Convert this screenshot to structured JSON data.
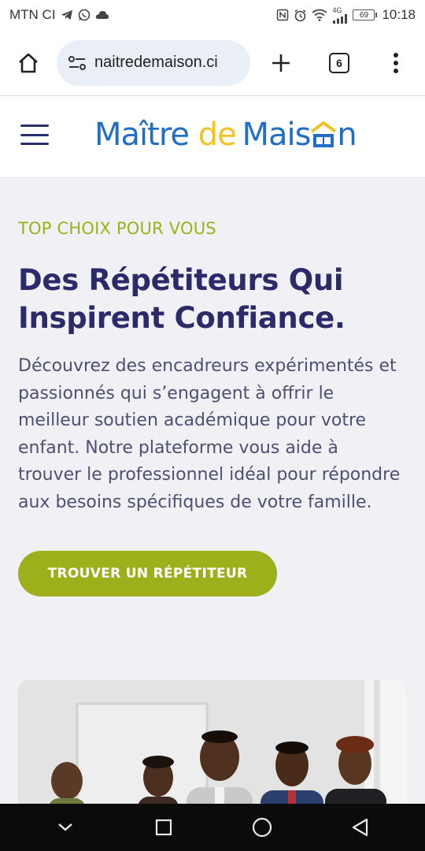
{
  "status_bar": {
    "carrier": "MTN CI",
    "time": "10:18",
    "battery_level": "69",
    "network": "4G",
    "icons_left": [
      "telegram-icon",
      "whatsapp-icon",
      "cloud-icon"
    ],
    "icons_right": [
      "nfc-icon",
      "alarm-icon",
      "wifi-icon",
      "signal-icon",
      "battery-icon"
    ]
  },
  "browser": {
    "url": "naitredemaison.ci",
    "tab_count": "6",
    "icons": [
      "home-icon",
      "site-settings-icon",
      "new-tab-icon",
      "tabs-icon",
      "more-menu-icon"
    ]
  },
  "site_header": {
    "logo_part1": "Maître",
    "logo_part2": "de",
    "logo_part3": "Mais",
    "logo_part4": "n"
  },
  "hero": {
    "eyebrow": "TOP CHOIX POUR VOUS",
    "headline_line1": "Des Répétiteurs Qui",
    "headline_line2": "Inspirent Confiance.",
    "description": "Découvrez des encadreurs expérimentés et passionnés qui s’engagent à offrir le meilleur soutien académique pour votre enfant. Notre plateforme vous aide à trouver le professionnel idéal pour répondre aux besoins spécifiques de votre famille.",
    "cta_label": "TROUVER UN RÉPÉTITEUR"
  },
  "colors": {
    "brand_blue": "#1f6fc9",
    "brand_yellow": "#f3c323",
    "accent_green": "#9db01c",
    "heading_navy": "#2b2a6a",
    "body_text": "#4d4f73"
  },
  "nav_bar": {
    "icons": [
      "back-chevron-icon",
      "recents-square-icon",
      "home-circle-icon",
      "back-triangle-icon"
    ]
  }
}
